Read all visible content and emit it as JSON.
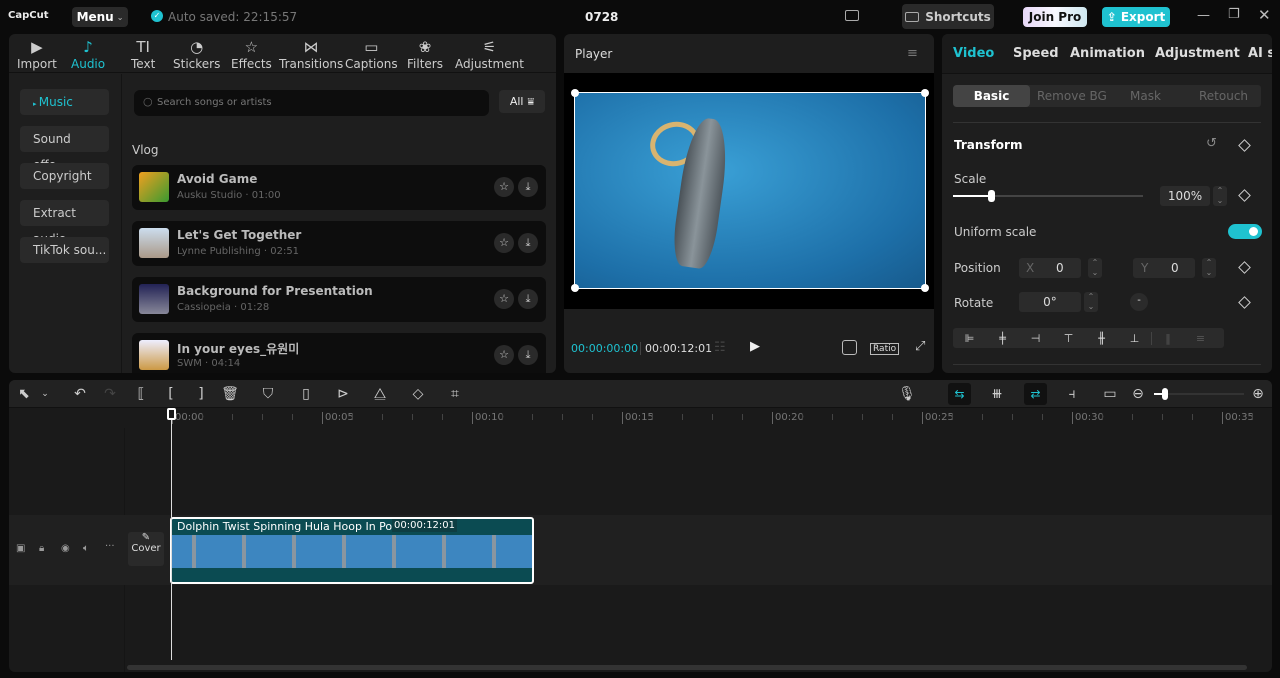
{
  "app": {
    "logo": "CapCut",
    "menu": "Menu",
    "autosave": "Auto saved: 22:15:57",
    "project": "0728",
    "shortcuts": "Shortcuts",
    "join_pro": "Join Pro",
    "export": "Export"
  },
  "media_tabs": [
    {
      "label": "Import",
      "icon": "import-icon"
    },
    {
      "label": "Audio",
      "icon": "audio-icon"
    },
    {
      "label": "Text",
      "icon": "text-icon"
    },
    {
      "label": "Stickers",
      "icon": "stickers-icon"
    },
    {
      "label": "Effects",
      "icon": "effects-icon"
    },
    {
      "label": "Transitions",
      "icon": "transitions-icon"
    },
    {
      "label": "Captions",
      "icon": "captions-icon"
    },
    {
      "label": "Filters",
      "icon": "filters-icon"
    },
    {
      "label": "Adjustment",
      "icon": "adjustment-icon"
    }
  ],
  "audio_sidebar": [
    "Music",
    "Sound effe...",
    "Copyright",
    "Extract audio",
    "TikTok sou..."
  ],
  "search": {
    "placeholder": "Search songs or artists",
    "filter": "All"
  },
  "section": "Vlog",
  "songs": [
    {
      "title": "Avoid Game",
      "sub": "Ausku Studio · 01:00"
    },
    {
      "title": "Let's Get Together",
      "sub": "Lynne Publishing · 02:51"
    },
    {
      "title": "Background for Presentation",
      "sub": "Cassiopeia · 01:28"
    },
    {
      "title": "In your eyes_유원미",
      "sub": "SWM · 04:14"
    }
  ],
  "player": {
    "title": "Player",
    "current": "00:00:00:00",
    "duration": "00:00:12:01",
    "ratio": "Ratio"
  },
  "inspector": {
    "tabs": [
      "Video",
      "Speed",
      "Animation",
      "Adjustment",
      "AI st"
    ],
    "subtabs": [
      "Basic",
      "Remove BG",
      "Mask",
      "Retouch"
    ],
    "section": "Transform",
    "scale_label": "Scale",
    "scale_value": "100%",
    "scale_percent": 100,
    "uniform": "Uniform scale",
    "uniform_on": true,
    "position": "Position",
    "x_label": "X",
    "x": "0",
    "y_label": "Y",
    "y": "0",
    "rotate": "Rotate",
    "rotate_value": "0°"
  },
  "timeline": {
    "ticks": [
      "00:00",
      "00:05",
      "00:10",
      "00:15",
      "00:20",
      "00:25",
      "00:30",
      "00:35"
    ],
    "clip_title": "Dolphin Twist Spinning Hula Hoop In Pool",
    "clip_duration": "00:00:12:01",
    "cover": "Cover"
  },
  "colors": {
    "accent": "#1fc2d0",
    "clip": "#0b4b52"
  }
}
